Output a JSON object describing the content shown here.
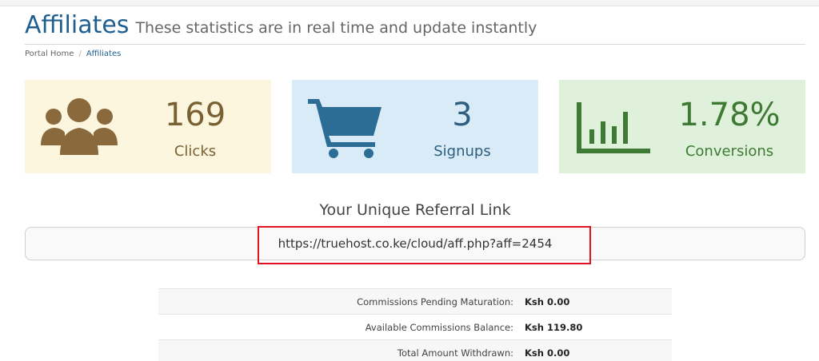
{
  "header": {
    "title": "Affiliates",
    "subtitle": "These statistics are in real time and update instantly"
  },
  "breadcrumb": {
    "home": "Portal Home",
    "separator": "/",
    "current": "Affiliates"
  },
  "stats": {
    "clicks": {
      "value": "169",
      "label": "Clicks",
      "icon": "users-icon",
      "color": "#7a6134"
    },
    "signups": {
      "value": "3",
      "label": "Signups",
      "icon": "shopping-cart-icon",
      "color": "#2c5f80"
    },
    "conversions": {
      "value": "1.78%",
      "label": "Conversions",
      "icon": "bar-chart-icon",
      "color": "#3f7a34"
    }
  },
  "referral": {
    "heading": "Your Unique Referral Link",
    "link": "https://truehost.co.ke/cloud/aff.php?aff=2454"
  },
  "commissions": [
    {
      "label": "Commissions Pending Maturation:",
      "value": "Ksh 0.00"
    },
    {
      "label": "Available Commissions Balance:",
      "value": "Ksh 119.80"
    },
    {
      "label": "Total Amount Withdrawn:",
      "value": "Ksh 0.00"
    }
  ]
}
